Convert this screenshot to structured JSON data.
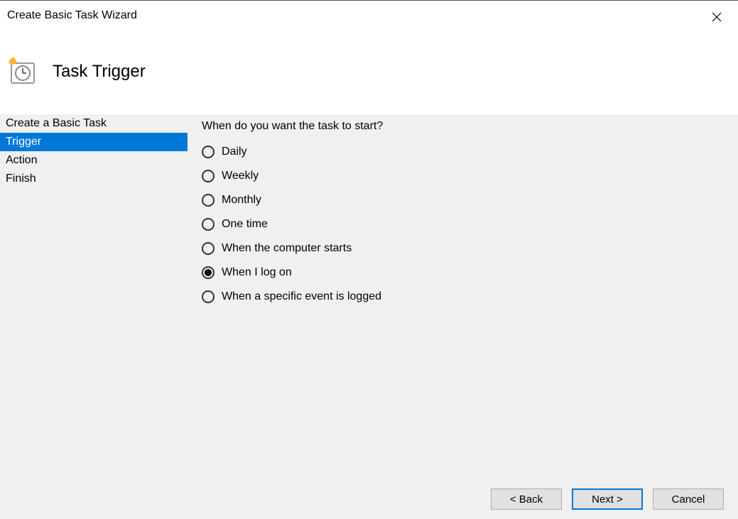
{
  "window": {
    "title": "Create Basic Task Wizard"
  },
  "header": {
    "title": "Task Trigger"
  },
  "sidebar": {
    "items": [
      {
        "label": "Create a Basic Task",
        "selected": false
      },
      {
        "label": "Trigger",
        "selected": true
      },
      {
        "label": "Action",
        "selected": false
      },
      {
        "label": "Finish",
        "selected": false
      }
    ]
  },
  "main": {
    "question": "When do you want the task to start?",
    "options": [
      {
        "label": "Daily",
        "checked": false
      },
      {
        "label": "Weekly",
        "checked": false
      },
      {
        "label": "Monthly",
        "checked": false
      },
      {
        "label": "One time",
        "checked": false
      },
      {
        "label": "When the computer starts",
        "checked": false
      },
      {
        "label": "When I log on",
        "checked": true
      },
      {
        "label": "When a specific event is logged",
        "checked": false
      }
    ]
  },
  "buttons": {
    "back": "< Back",
    "next": "Next >",
    "cancel": "Cancel"
  }
}
